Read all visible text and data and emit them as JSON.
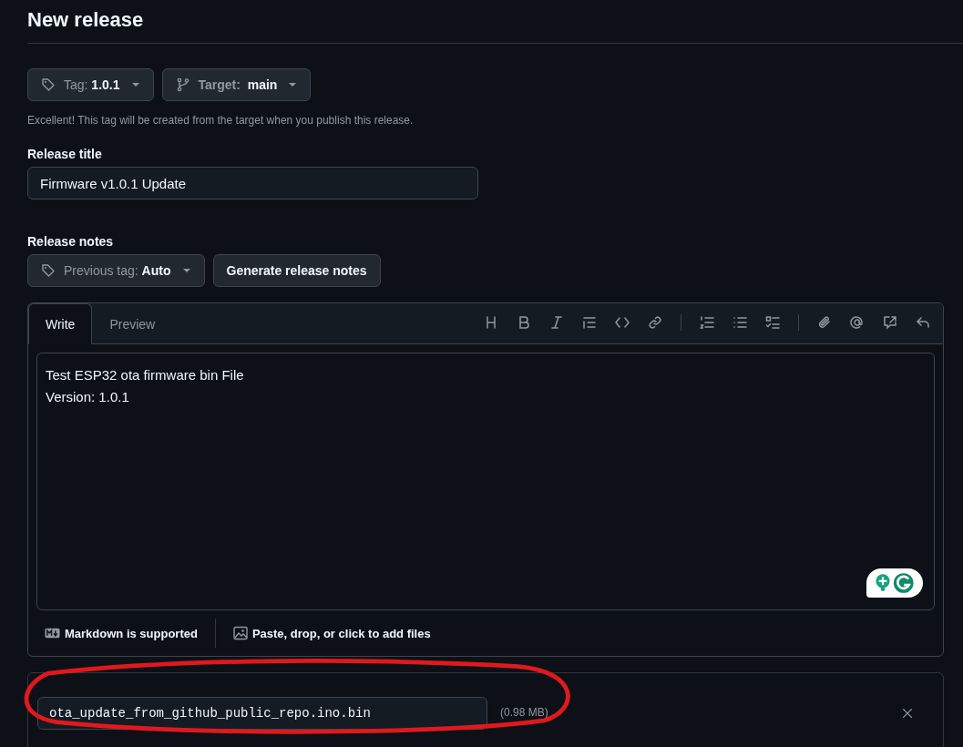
{
  "heading": "New release",
  "tag_button": {
    "label": "Tag:",
    "value": "1.0.1"
  },
  "target_button": {
    "label": "Target:",
    "value": "main"
  },
  "hint": "Excellent! This tag will be created from the target when you publish this release.",
  "release_title": {
    "label": "Release title",
    "value": "Firmware v1.0.1 Update"
  },
  "release_notes": {
    "label": "Release notes"
  },
  "previous_tag_button": {
    "label": "Previous tag:",
    "value": "Auto"
  },
  "generate_button": "Generate release notes",
  "editor": {
    "tabs": [
      {
        "label": "Write",
        "selected": true
      },
      {
        "label": "Preview",
        "selected": false
      }
    ],
    "body": "Test ESP32 ota firmware bin File\nVersion: 1.0.1",
    "markdown_note": "Markdown is supported",
    "attach_note": "Paste, drop, or click to add files"
  },
  "attachment": {
    "filename": "ota_update_from_github_public_repo.ino.bin",
    "size": "(0.98 MB)"
  }
}
